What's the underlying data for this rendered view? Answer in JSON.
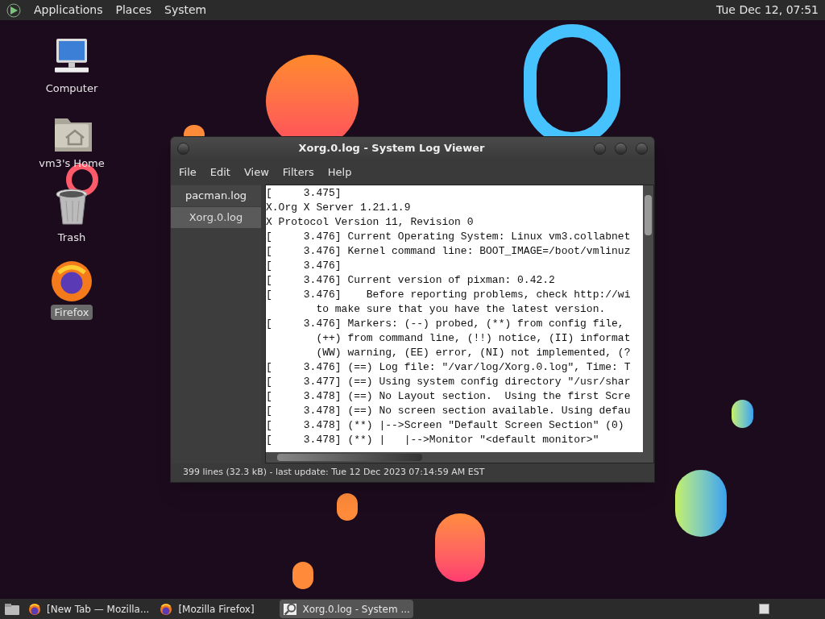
{
  "top_panel": {
    "menus": [
      "Applications",
      "Places",
      "System"
    ],
    "clock": "Tue Dec 12, 07:51"
  },
  "desktop_icons": [
    {
      "kind": "computer",
      "label": "Computer",
      "selected": false
    },
    {
      "kind": "home",
      "label": "vm3's Home",
      "selected": false
    },
    {
      "kind": "trash",
      "label": "Trash",
      "selected": false
    },
    {
      "kind": "firefox",
      "label": "Firefox",
      "selected": true
    }
  ],
  "window": {
    "title": "Xorg.0.log - System Log Viewer",
    "menu": [
      "File",
      "Edit",
      "View",
      "Filters",
      "Help"
    ],
    "logs": [
      {
        "label": "pacman.log",
        "selected": false
      },
      {
        "label": "Xorg.0.log",
        "selected": true
      }
    ],
    "lines": [
      "[     3.475]",
      "X.Org X Server 1.21.1.9",
      "X Protocol Version 11, Revision 0",
      "[     3.476] Current Operating System: Linux vm3.collabnet",
      "[     3.476] Kernel command line: BOOT_IMAGE=/boot/vmlinuz",
      "[     3.476]",
      "[     3.476] Current version of pixman: 0.42.2",
      "[     3.476]    Before reporting problems, check http://wi",
      "        to make sure that you have the latest version.",
      "[     3.476] Markers: (--) probed, (**) from config file,",
      "        (++) from command line, (!!) notice, (II) informat",
      "        (WW) warning, (EE) error, (NI) not implemented, (?",
      "[     3.476] (==) Log file: \"/var/log/Xorg.0.log\", Time: T",
      "[     3.477] (==) Using system config directory \"/usr/shar",
      "[     3.478] (==) No Layout section.  Using the first Scre",
      "[     3.478] (==) No screen section available. Using defau",
      "[     3.478] (**) |-->Screen \"Default Screen Section\" (0)",
      "[     3.478] (**) |   |-->Monitor \"<default monitor>\""
    ],
    "status": "399 lines (32.3 kB) - last update: Tue 12 Dec 2023 07:14:59 AM EST"
  },
  "taskbar": [
    {
      "kind": "firefox",
      "label": "[New Tab — Mozilla...",
      "selected": false
    },
    {
      "kind": "firefox",
      "label": "[Mozilla Firefox]",
      "selected": false
    },
    {
      "kind": "logviewer",
      "label": "Xorg.0.log - System ...",
      "selected": true
    }
  ]
}
